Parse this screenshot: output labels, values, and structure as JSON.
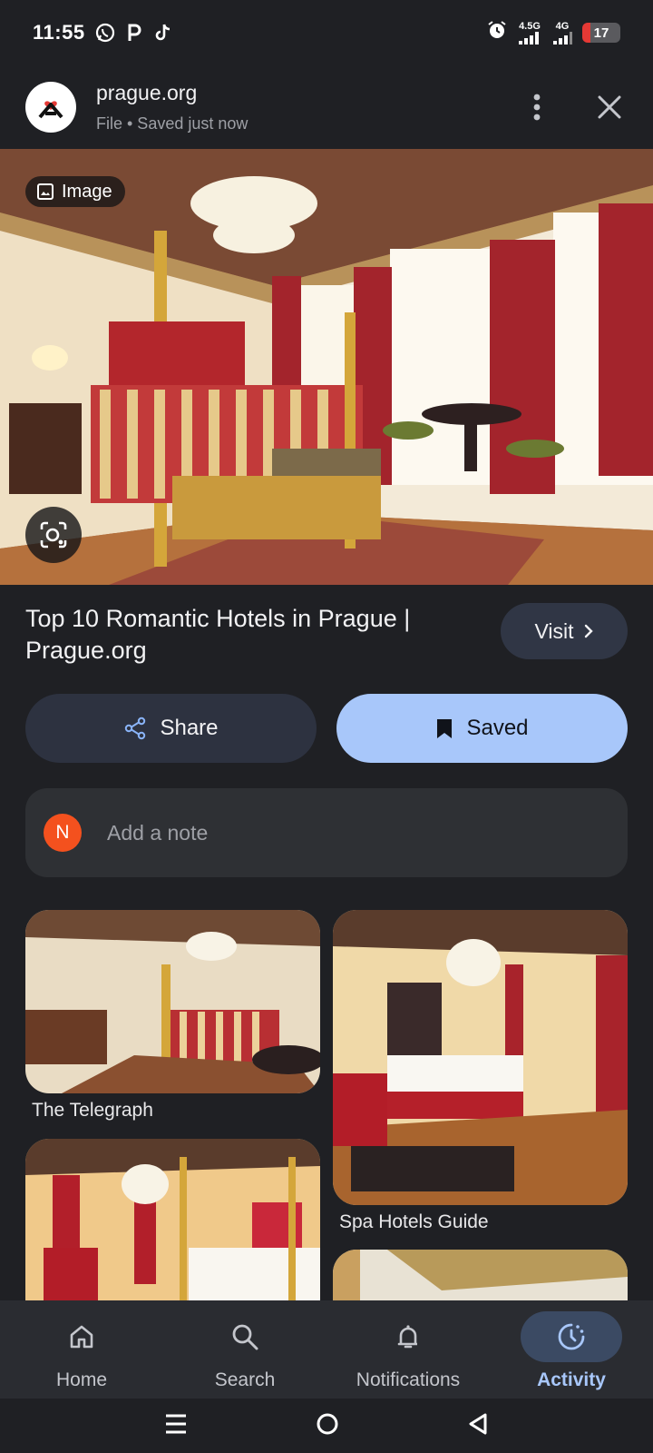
{
  "status_bar": {
    "time": "11:55",
    "notification_icons": [
      "whatsapp-icon",
      "p-app-icon",
      "tiktok-icon"
    ],
    "alarm_icon": "alarm-icon",
    "network_1": "4.5G",
    "network_2": "4G",
    "battery_level": "17"
  },
  "header": {
    "site_name": "prague.org",
    "subtitle": "File • Saved just now"
  },
  "hero": {
    "badge_label": "Image"
  },
  "page": {
    "title": "Top 10 Romantic Hotels in Prague | Prague.org",
    "visit_label": "Visit"
  },
  "actions": {
    "share_label": "Share",
    "saved_label": "Saved"
  },
  "note": {
    "avatar_initial": "N",
    "placeholder": "Add a note"
  },
  "related": [
    {
      "source": "The Telegraph"
    },
    {
      "source": "Spa Hotels Guide"
    },
    {
      "source": ""
    },
    {
      "source": ""
    }
  ],
  "bottom_nav": {
    "items": [
      {
        "label": "Home",
        "icon": "home-icon"
      },
      {
        "label": "Search",
        "icon": "search-icon"
      },
      {
        "label": "Notifications",
        "icon": "bell-icon"
      },
      {
        "label": "Activity",
        "icon": "activity-icon"
      }
    ],
    "active": "Activity"
  },
  "colors": {
    "background": "#1f2024",
    "accent": "#a8c7fa",
    "note_avatar": "#f4511e"
  }
}
